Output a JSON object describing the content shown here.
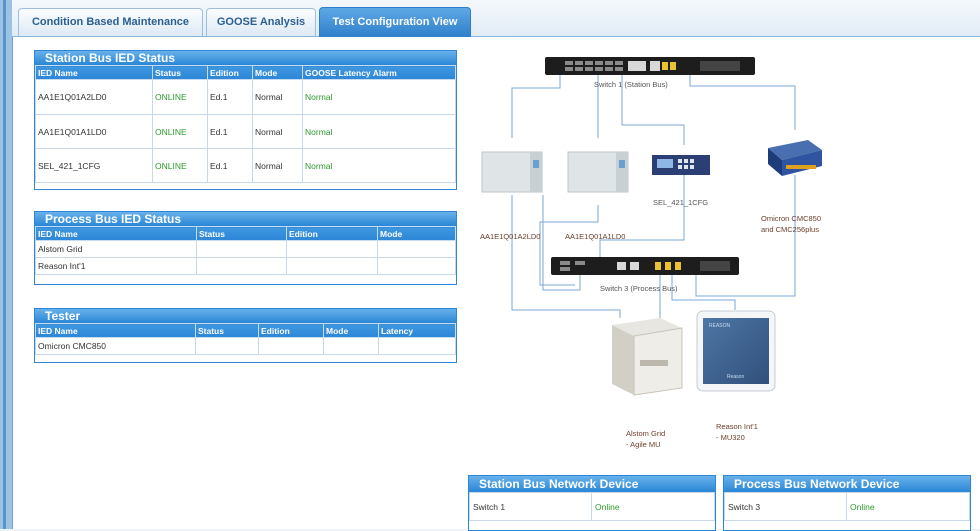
{
  "tabs": [
    {
      "label": "Condition Based Maintenance",
      "active": false
    },
    {
      "label": "GOOSE Analysis",
      "active": false
    },
    {
      "label": "Test Configuration View",
      "active": true
    }
  ],
  "station_bus": {
    "title": "Station Bus IED Status",
    "headers": [
      "IED Name",
      "Status",
      "Edition",
      "Mode",
      "GOOSE Latency Alarm"
    ],
    "rows": [
      [
        "AA1E1Q01A2LD0",
        "ONLINE",
        "Ed.1",
        "Normal",
        "Normal"
      ],
      [
        "AA1E1Q01A1LD0",
        "ONLINE",
        "Ed.1",
        "Normal",
        "Normal"
      ],
      [
        "SEL_421_1CFG",
        "ONLINE",
        "Ed.1",
        "Normal",
        "Normal"
      ]
    ]
  },
  "process_bus": {
    "title": "Process Bus IED Status",
    "headers": [
      "IED Name",
      "Status",
      "Edition",
      "Mode"
    ],
    "rows": [
      [
        "Alstom Grid",
        "",
        "",
        ""
      ],
      [
        "Reason Int'1",
        "",
        "",
        ""
      ]
    ]
  },
  "tester": {
    "title": "Tester",
    "headers": [
      "IED Name",
      "Status",
      "Edition",
      "Mode",
      "Latency"
    ],
    "rows": [
      [
        "Omicron CMC850",
        "",
        "",
        "",
        ""
      ]
    ]
  },
  "diagram": {
    "switch1": "Switch 1 (Station Bus)",
    "switch3": "Switch 3 (Process Bus)",
    "ied1": "AA1E1Q01A2LD0",
    "ied2": "AA1E1Q01A1LD0",
    "sel": "SEL_421_1CFG",
    "omicron_1": "Omicron CMC850",
    "omicron_2": "and CMC256plus",
    "alstom_1": "Alstom Grid",
    "alstom_2": "- Agile MU",
    "reason_1": "Reason Int'1",
    "reason_2": "- MU320",
    "reason_logo": "REASON",
    "reason_brand": "Reason"
  },
  "station_net": {
    "title": "Station Bus Network Device",
    "device": "Switch 1",
    "status": "Online"
  },
  "process_net": {
    "title": "Process Bus Network Device",
    "device": "Switch 3",
    "status": "Online"
  },
  "colors": {
    "accent": "#2f86d6",
    "online": "#2e9a2e",
    "label": "#6b3d2a"
  }
}
